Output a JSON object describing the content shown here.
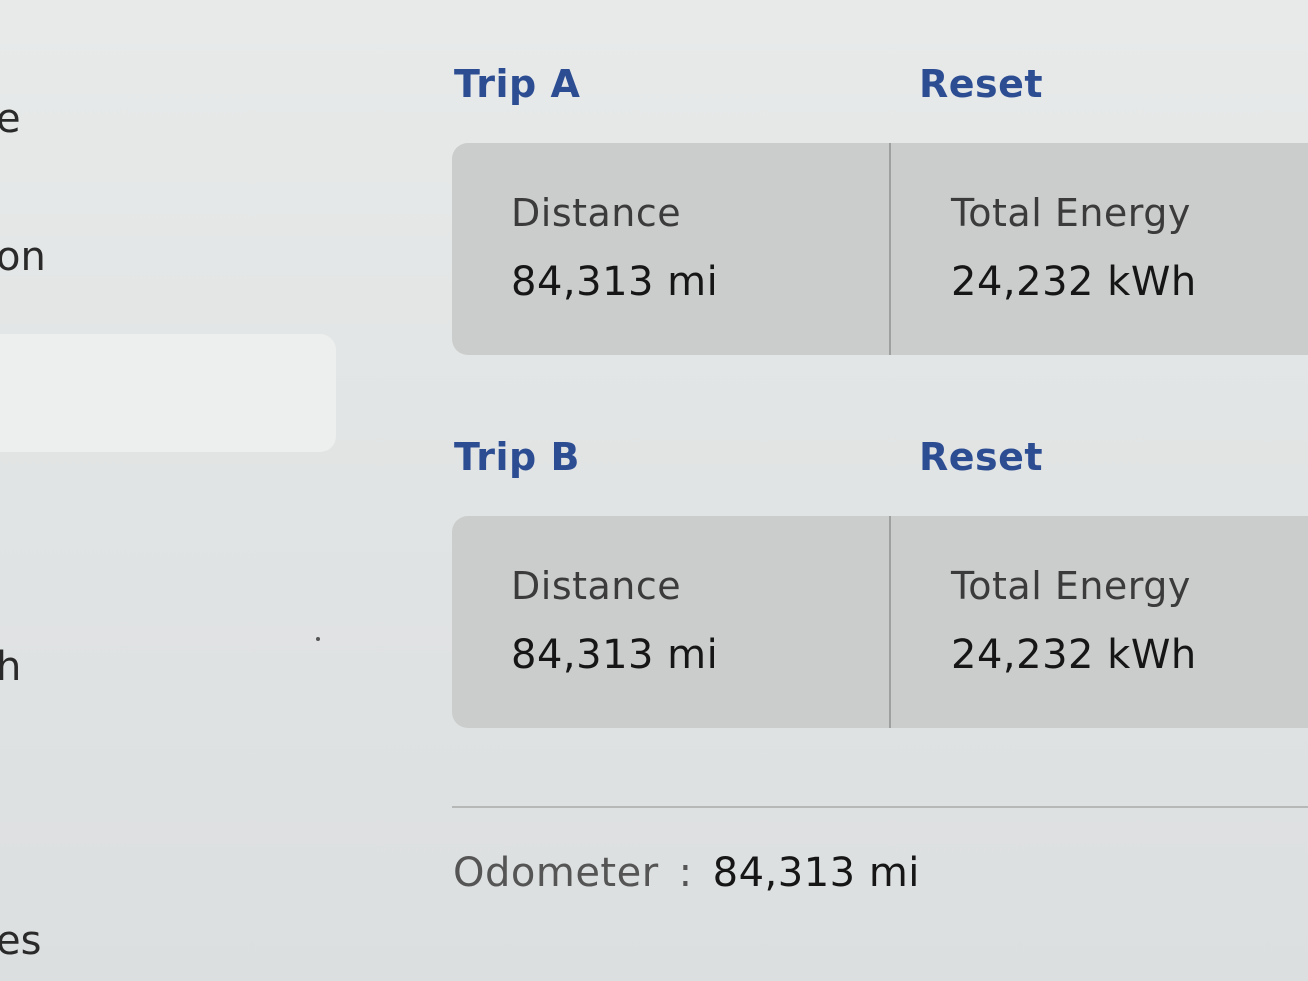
{
  "sidebar": {
    "fragments": [
      "e",
      "on",
      "h",
      "es"
    ]
  },
  "trips": [
    {
      "title": "Trip A",
      "reset_label": "Reset",
      "distance_label": "Distance",
      "distance_value": "84,313  mi",
      "energy_label": "Total Energy",
      "energy_value": "24,232  kWh"
    },
    {
      "title": "Trip B",
      "reset_label": "Reset",
      "distance_label": "Distance",
      "distance_value": "84,313  mi",
      "energy_label": "Total Energy",
      "energy_value": "24,232  kWh"
    }
  ],
  "odometer": {
    "label": "Odometer",
    "separator": ":",
    "value": "84,313  mi"
  },
  "colors": {
    "accent": "#2d4d93",
    "card": "#cbcdcc",
    "background": "#e4e6e6"
  }
}
